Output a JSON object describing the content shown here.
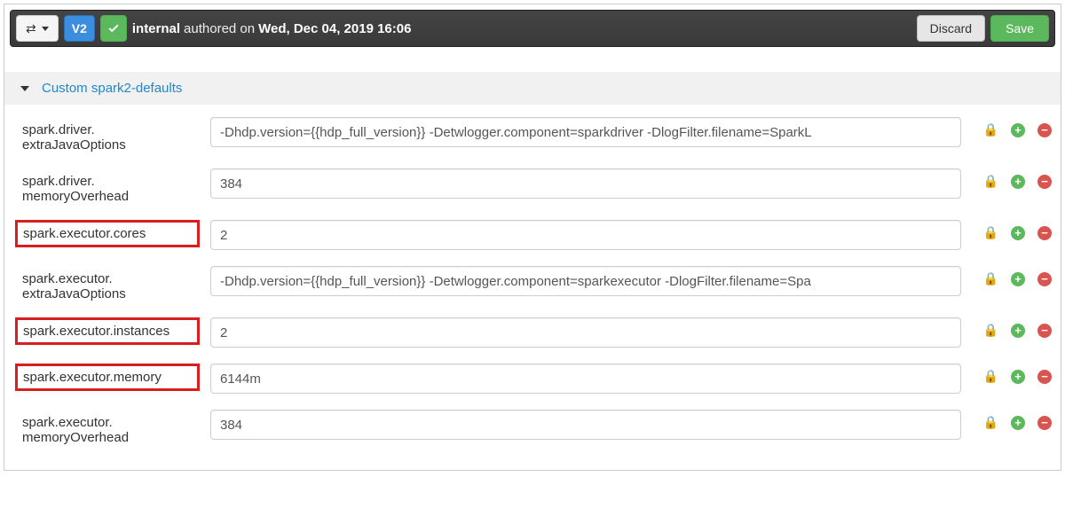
{
  "topbar": {
    "version_badge": "V2",
    "author": "internal",
    "authored_word": "authored on",
    "date": "Wed, Dec 04, 2019 16:06",
    "discard": "Discard",
    "save": "Save"
  },
  "section": {
    "title": "Custom spark2-defaults"
  },
  "properties": [
    {
      "key_display": "spark.driver. extraJavaOptions",
      "highlight": false,
      "value": "-Dhdp.version={{hdp_full_version}} -Detwlogger.component=sparkdriver -DlogFilter.filename=SparkL"
    },
    {
      "key_display": "spark.driver. memoryOverhead",
      "highlight": false,
      "value": "384"
    },
    {
      "key_display": "spark.executor.cores",
      "highlight": true,
      "value": "2"
    },
    {
      "key_display": "spark.executor. extraJavaOptions",
      "highlight": false,
      "value": "-Dhdp.version={{hdp_full_version}} -Detwlogger.component=sparkexecutor -DlogFilter.filename=Spa"
    },
    {
      "key_display": "spark.executor.instances",
      "highlight": true,
      "value": "2"
    },
    {
      "key_display": "spark.executor.memory",
      "highlight": true,
      "value": "6144m"
    },
    {
      "key_display": "spark.executor. memoryOverhead",
      "highlight": false,
      "value": "384"
    }
  ]
}
